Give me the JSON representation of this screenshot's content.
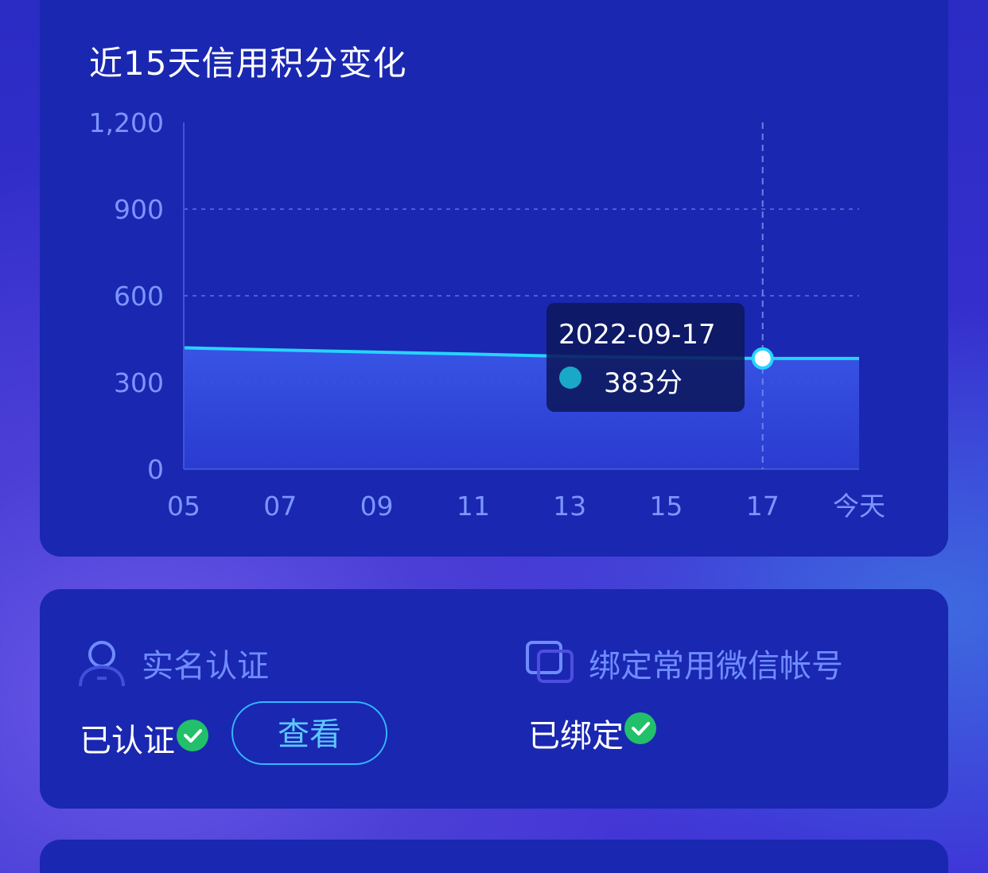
{
  "chart_card": {
    "title": "近15天信用积分变化",
    "tooltip": {
      "date": "2022-09-17",
      "value": "383分"
    }
  },
  "chart_data": {
    "type": "area",
    "title": "近15天信用积分变化",
    "x": [
      "05",
      "07",
      "09",
      "11",
      "13",
      "15",
      "17",
      "今天"
    ],
    "y_tick_labels": [
      "0",
      "300",
      "600",
      "900",
      "1,200"
    ],
    "ylim": [
      0,
      1200
    ],
    "grid": true,
    "series": [
      {
        "values": [
          420,
          412,
          405,
          398,
          390,
          386,
          383,
          383
        ]
      }
    ],
    "highlight": {
      "x": "17",
      "date": "2022-09-17",
      "value": 383
    },
    "colors": {
      "line": "#27d3ff",
      "area_top": "#3a56e8",
      "area_bottom": "#2d3fd6"
    }
  },
  "verify_card": {
    "real_name": {
      "icon": "user-icon",
      "label": "实名认证",
      "status": "已认证",
      "view_button": "查看"
    },
    "wechat": {
      "icon": "copy-icon",
      "label": "绑定常用微信帐号",
      "status": "已绑定"
    }
  },
  "colors": {
    "card": "#1a27b0",
    "accent": "#33b6ff",
    "check": "#22c06a"
  }
}
